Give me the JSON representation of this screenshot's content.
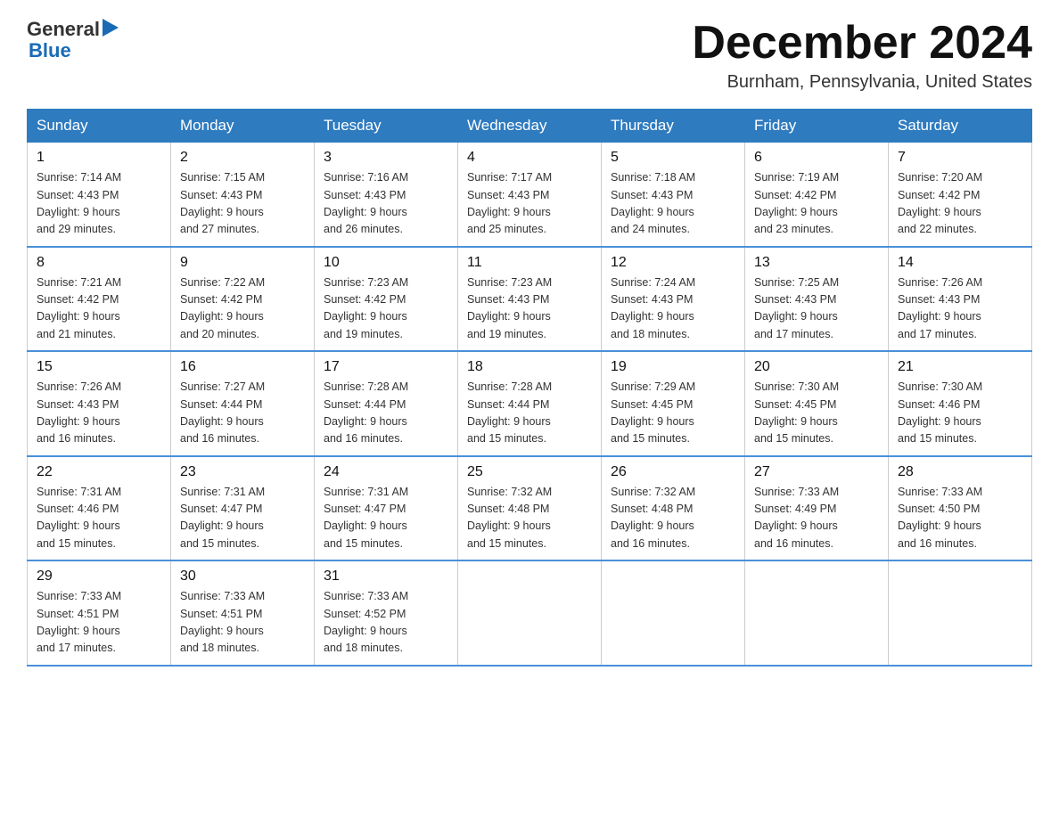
{
  "header": {
    "logo_general": "General",
    "logo_blue": "Blue",
    "month_title": "December 2024",
    "location": "Burnham, Pennsylvania, United States"
  },
  "weekdays": [
    "Sunday",
    "Monday",
    "Tuesday",
    "Wednesday",
    "Thursday",
    "Friday",
    "Saturday"
  ],
  "weeks": [
    [
      {
        "day": "1",
        "sunrise": "7:14 AM",
        "sunset": "4:43 PM",
        "daylight": "9 hours and 29 minutes."
      },
      {
        "day": "2",
        "sunrise": "7:15 AM",
        "sunset": "4:43 PM",
        "daylight": "9 hours and 27 minutes."
      },
      {
        "day": "3",
        "sunrise": "7:16 AM",
        "sunset": "4:43 PM",
        "daylight": "9 hours and 26 minutes."
      },
      {
        "day": "4",
        "sunrise": "7:17 AM",
        "sunset": "4:43 PM",
        "daylight": "9 hours and 25 minutes."
      },
      {
        "day": "5",
        "sunrise": "7:18 AM",
        "sunset": "4:43 PM",
        "daylight": "9 hours and 24 minutes."
      },
      {
        "day": "6",
        "sunrise": "7:19 AM",
        "sunset": "4:42 PM",
        "daylight": "9 hours and 23 minutes."
      },
      {
        "day": "7",
        "sunrise": "7:20 AM",
        "sunset": "4:42 PM",
        "daylight": "9 hours and 22 minutes."
      }
    ],
    [
      {
        "day": "8",
        "sunrise": "7:21 AM",
        "sunset": "4:42 PM",
        "daylight": "9 hours and 21 minutes."
      },
      {
        "day": "9",
        "sunrise": "7:22 AM",
        "sunset": "4:42 PM",
        "daylight": "9 hours and 20 minutes."
      },
      {
        "day": "10",
        "sunrise": "7:23 AM",
        "sunset": "4:42 PM",
        "daylight": "9 hours and 19 minutes."
      },
      {
        "day": "11",
        "sunrise": "7:23 AM",
        "sunset": "4:43 PM",
        "daylight": "9 hours and 19 minutes."
      },
      {
        "day": "12",
        "sunrise": "7:24 AM",
        "sunset": "4:43 PM",
        "daylight": "9 hours and 18 minutes."
      },
      {
        "day": "13",
        "sunrise": "7:25 AM",
        "sunset": "4:43 PM",
        "daylight": "9 hours and 17 minutes."
      },
      {
        "day": "14",
        "sunrise": "7:26 AM",
        "sunset": "4:43 PM",
        "daylight": "9 hours and 17 minutes."
      }
    ],
    [
      {
        "day": "15",
        "sunrise": "7:26 AM",
        "sunset": "4:43 PM",
        "daylight": "9 hours and 16 minutes."
      },
      {
        "day": "16",
        "sunrise": "7:27 AM",
        "sunset": "4:44 PM",
        "daylight": "9 hours and 16 minutes."
      },
      {
        "day": "17",
        "sunrise": "7:28 AM",
        "sunset": "4:44 PM",
        "daylight": "9 hours and 16 minutes."
      },
      {
        "day": "18",
        "sunrise": "7:28 AM",
        "sunset": "4:44 PM",
        "daylight": "9 hours and 15 minutes."
      },
      {
        "day": "19",
        "sunrise": "7:29 AM",
        "sunset": "4:45 PM",
        "daylight": "9 hours and 15 minutes."
      },
      {
        "day": "20",
        "sunrise": "7:30 AM",
        "sunset": "4:45 PM",
        "daylight": "9 hours and 15 minutes."
      },
      {
        "day": "21",
        "sunrise": "7:30 AM",
        "sunset": "4:46 PM",
        "daylight": "9 hours and 15 minutes."
      }
    ],
    [
      {
        "day": "22",
        "sunrise": "7:31 AM",
        "sunset": "4:46 PM",
        "daylight": "9 hours and 15 minutes."
      },
      {
        "day": "23",
        "sunrise": "7:31 AM",
        "sunset": "4:47 PM",
        "daylight": "9 hours and 15 minutes."
      },
      {
        "day": "24",
        "sunrise": "7:31 AM",
        "sunset": "4:47 PM",
        "daylight": "9 hours and 15 minutes."
      },
      {
        "day": "25",
        "sunrise": "7:32 AM",
        "sunset": "4:48 PM",
        "daylight": "9 hours and 15 minutes."
      },
      {
        "day": "26",
        "sunrise": "7:32 AM",
        "sunset": "4:48 PM",
        "daylight": "9 hours and 16 minutes."
      },
      {
        "day": "27",
        "sunrise": "7:33 AM",
        "sunset": "4:49 PM",
        "daylight": "9 hours and 16 minutes."
      },
      {
        "day": "28",
        "sunrise": "7:33 AM",
        "sunset": "4:50 PM",
        "daylight": "9 hours and 16 minutes."
      }
    ],
    [
      {
        "day": "29",
        "sunrise": "7:33 AM",
        "sunset": "4:51 PM",
        "daylight": "9 hours and 17 minutes."
      },
      {
        "day": "30",
        "sunrise": "7:33 AM",
        "sunset": "4:51 PM",
        "daylight": "9 hours and 18 minutes."
      },
      {
        "day": "31",
        "sunrise": "7:33 AM",
        "sunset": "4:52 PM",
        "daylight": "9 hours and 18 minutes."
      },
      null,
      null,
      null,
      null
    ]
  ],
  "labels": {
    "sunrise_prefix": "Sunrise: ",
    "sunset_prefix": "Sunset: ",
    "daylight_prefix": "Daylight: 9 hours"
  }
}
